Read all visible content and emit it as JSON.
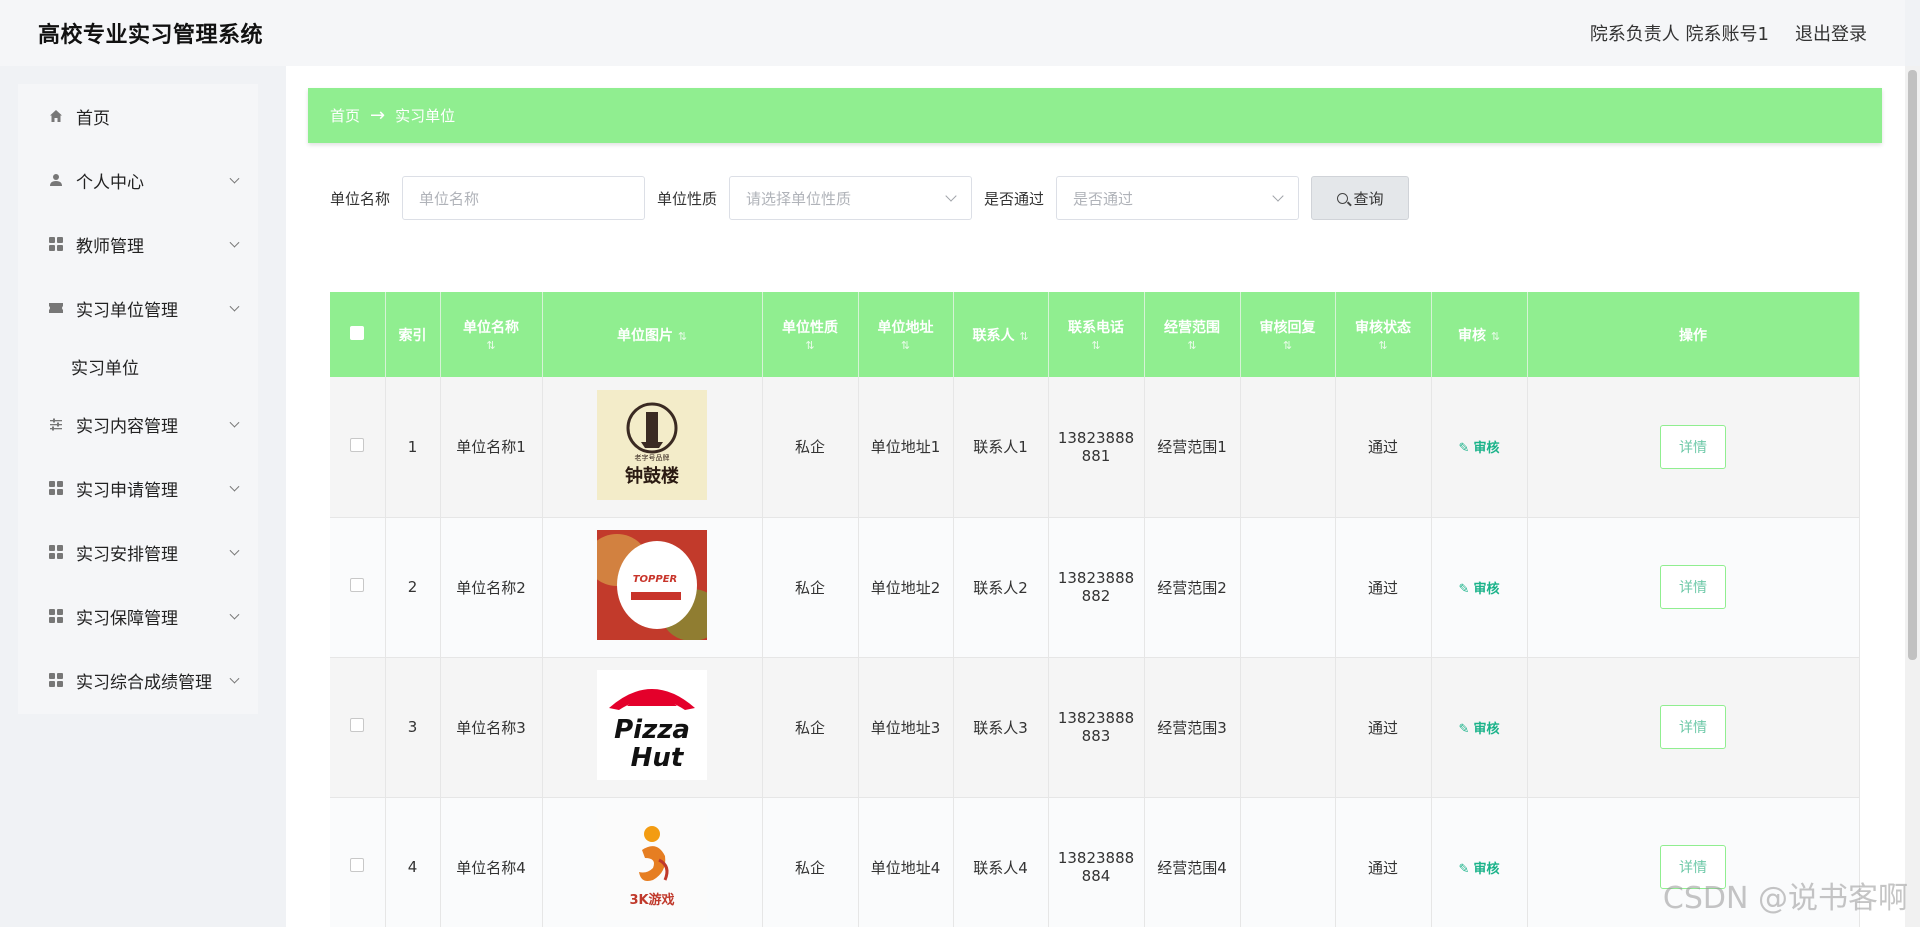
{
  "header": {
    "title": "高校专业实习管理系统",
    "user": "院系负责人 院系账号1",
    "logout": "退出登录"
  },
  "sidebar": {
    "items": [
      {
        "label": "首页",
        "icon": "home-icon",
        "chevron": false
      },
      {
        "label": "个人中心",
        "icon": "user-icon",
        "chevron": true
      },
      {
        "label": "教师管理",
        "icon": "grid-icon",
        "chevron": true
      },
      {
        "label": "实习单位管理",
        "icon": "ticket-icon",
        "chevron": true
      },
      {
        "label": "实习内容管理",
        "icon": "sliders-icon",
        "chevron": true
      },
      {
        "label": "实习申请管理",
        "icon": "grid-icon",
        "chevron": true
      },
      {
        "label": "实习安排管理",
        "icon": "grid-icon",
        "chevron": true
      },
      {
        "label": "实习保障管理",
        "icon": "grid-icon",
        "chevron": true
      },
      {
        "label": "实习综合成绩管理",
        "icon": "grid-icon",
        "chevron": true
      }
    ],
    "submenu_label": "实习单位"
  },
  "breadcrumb": {
    "home": "首页",
    "arrow": "→",
    "current": "实习单位"
  },
  "filters": {
    "name_label": "单位名称",
    "name_placeholder": "单位名称",
    "type_label": "单位性质",
    "type_placeholder": "请选择单位性质",
    "pass_label": "是否通过",
    "pass_placeholder": "是否通过",
    "query_label": "查询"
  },
  "table": {
    "headers": [
      "索引",
      "单位名称",
      "单位图片",
      "单位性质",
      "单位地址",
      "联系人",
      "联系电话",
      "经营范围",
      "审核回复",
      "审核状态",
      "审核",
      "操作"
    ],
    "rows": [
      {
        "index": "1",
        "name": "单位名称1",
        "image": "tower-logo",
        "type": "私企",
        "address": "单位地址1",
        "contact": "联系人1",
        "phone_a": "13823888",
        "phone_b": "881",
        "scope": "经营范围1",
        "reply": "",
        "status": "通过",
        "audit": "审核",
        "detail": "详情"
      },
      {
        "index": "2",
        "name": "单位名称2",
        "image": "burger-logo",
        "type": "私企",
        "address": "单位地址2",
        "contact": "联系人2",
        "phone_a": "13823888",
        "phone_b": "882",
        "scope": "经营范围2",
        "reply": "",
        "status": "通过",
        "audit": "审核",
        "detail": "详情"
      },
      {
        "index": "3",
        "name": "单位名称3",
        "image": "pizza-hut-logo",
        "type": "私企",
        "address": "单位地址3",
        "contact": "联系人3",
        "phone_a": "13823888",
        "phone_b": "883",
        "scope": "经营范围3",
        "reply": "",
        "status": "通过",
        "audit": "审核",
        "detail": "详情"
      },
      {
        "index": "4",
        "name": "单位名称4",
        "image": "game-logo",
        "type": "私企",
        "address": "单位地址4",
        "contact": "联系人4",
        "phone_a": "13823888",
        "phone_b": "884",
        "scope": "经营范围4",
        "reply": "",
        "status": "通过",
        "audit": "审核",
        "detail": "详情"
      }
    ]
  },
  "logo_text": {
    "tower_main": "钟鼓楼",
    "tower_sub": "老字号品牌",
    "burger": "TOPPER",
    "pizza_1": "Pizza",
    "pizza_2": "Hut",
    "game": "3K游戏"
  },
  "watermark": "CSDN @说书客啊",
  "colors": {
    "accent": "#90ee90",
    "audit": "#1bb38a"
  }
}
